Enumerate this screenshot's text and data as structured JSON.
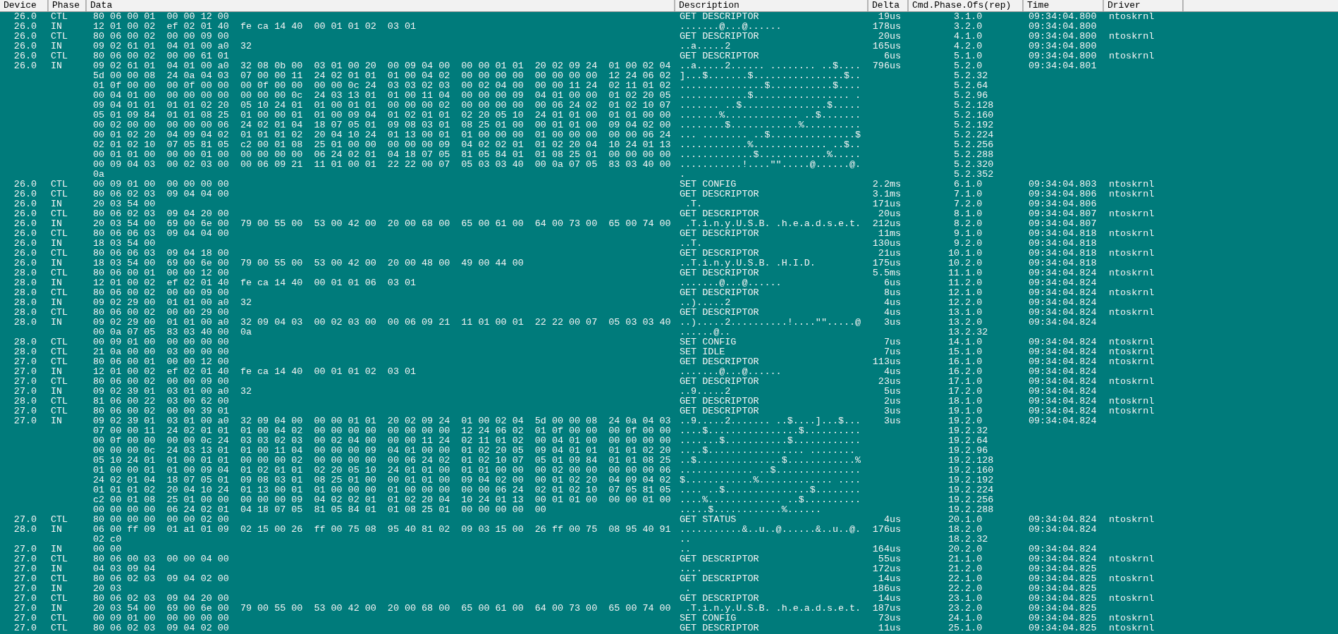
{
  "columns": [
    "Device",
    "Phase",
    "Data",
    "Description",
    "Delta",
    "Cmd.Phase.Ofs(rep)",
    "Time",
    "Driver"
  ],
  "rows": [
    {
      "device": "26.0",
      "phase": "CTL",
      "data": [
        "80 06 00 01  00 00 12 00"
      ],
      "description": [
        "GET DESCRIPTOR"
      ],
      "delta": "19us",
      "cmd": [
        "3.1.0"
      ],
      "time": "09:34:04.800",
      "driver": "ntoskrnl"
    },
    {
      "device": "26.0",
      "phase": "IN",
      "data": [
        "12 01 00 02  ef 02 01 40  fe ca 14 40  00 01 01 02  03 01"
      ],
      "description": [
        ".......@...@......"
      ],
      "delta": "178us",
      "cmd": [
        "3.2.0"
      ],
      "time": "09:34:04.800"
    },
    {
      "device": "26.0",
      "phase": "CTL",
      "data": [
        "80 06 00 02  00 00 09 00"
      ],
      "description": [
        "GET DESCRIPTOR"
      ],
      "delta": "20us",
      "cmd": [
        "4.1.0"
      ],
      "time": "09:34:04.800",
      "driver": "ntoskrnl"
    },
    {
      "device": "26.0",
      "phase": "IN",
      "data": [
        "09 02 61 01  04 01 00 a0  32"
      ],
      "description": [
        "..a.....2"
      ],
      "delta": "165us",
      "cmd": [
        "4.2.0"
      ],
      "time": "09:34:04.800"
    },
    {
      "device": "26.0",
      "phase": "CTL",
      "data": [
        "80 06 00 02  00 00 61 01"
      ],
      "description": [
        "GET DESCRIPTOR"
      ],
      "delta": "6us",
      "cmd": [
        "5.1.0"
      ],
      "time": "09:34:04.800",
      "driver": "ntoskrnl"
    },
    {
      "device": "26.0",
      "phase": "IN",
      "data": [
        "09 02 61 01  04 01 00 a0  32 08 0b 00  03 01 00 20  00 09 04 00  00 00 01 01  20 02 09 24  01 00 02 04",
        "5d 00 00 08  24 0a 04 03  07 00 00 11  24 02 01 01  01 00 04 02  00 00 00 00  00 00 00 00  12 24 06 02",
        "01 0f 00 00  00 0f 00 00  00 0f 00 00  00 00 0c 24  03 03 02 03  00 02 04 00  00 00 11 24  02 11 01 02",
        "00 04 01 00  00 00 00 00  00 00 00 0c  24 03 13 01  01 00 11 04  00 00 00 09  04 01 00 00  01 02 20 05",
        "09 04 01 01  01 01 02 20  05 10 24 01  01 00 01 01  00 00 00 02  00 00 00 00  00 06 24 02  01 02 10 07",
        "05 01 09 84  01 01 08 25  01 00 00 01  01 00 09 04  01 02 01 01  02 20 05 10  24 01 01 00  01 01 00 00",
        "00 02 00 00  00 00 00 06  24 02 01 04  18 07 05 01  09 08 03 01  08 25 01 00  00 01 01 00  09 04 02 00",
        "00 01 02 20  04 09 04 02  01 01 01 02  20 04 10 24  01 13 00 01  01 00 00 00  01 00 00 00  00 00 06 24",
        "02 01 02 10  07 05 81 05  c2 00 01 08  25 01 00 00  00 00 00 09  04 02 02 01  01 02 20 04  10 24 01 13",
        "00 01 01 00  00 00 01 00  00 00 00 00  06 24 02 01  04 18 07 05  81 05 84 01  01 08 25 01  00 00 00 00",
        "00 09 04 03  00 02 03 00  00 06 09 21  11 01 00 01  22 22 00 07  05 03 03 40  00 0a 07 05  83 03 40 00",
        "0a"
      ],
      "description": [
        "..a.....2...... ........ ..$....",
        "]...$.......$................$..",
        "...............$...........$....",
        "............$................. .",
        "....... ..$...............$.....",
        ".......%............. ..$.......",
        "........$............%..........",
        "... ........ ..$...............$",
        "............%............. ..$..",
        ".............$............%.....",
        "...........!....\"\".....@......@.",
        "."
      ],
      "delta": "796us",
      "cmd": [
        "5.2.0",
        "5.2.32",
        "5.2.64",
        "5.2.96",
        "5.2.128",
        "5.2.160",
        "5.2.192",
        "5.2.224",
        "5.2.256",
        "5.2.288",
        "5.2.320",
        "5.2.352"
      ],
      "time": "09:34:04.801"
    },
    {
      "device": "26.0",
      "phase": "CTL",
      "data": [
        "00 09 01 00  00 00 00 00"
      ],
      "description": [
        "SET CONFIG"
      ],
      "delta": "2.2ms",
      "cmd": [
        "6.1.0"
      ],
      "time": "09:34:04.803",
      "driver": "ntoskrnl"
    },
    {
      "device": "26.0",
      "phase": "CTL",
      "data": [
        "80 06 02 03  09 04 04 00"
      ],
      "description": [
        "GET DESCRIPTOR"
      ],
      "delta": "3.1ms",
      "cmd": [
        "7.1.0"
      ],
      "time": "09:34:04.806",
      "driver": "ntoskrnl"
    },
    {
      "device": "26.0",
      "phase": "IN",
      "data": [
        "20 03 54 00"
      ],
      "description": [
        " .T."
      ],
      "delta": "171us",
      "cmd": [
        "7.2.0"
      ],
      "time": "09:34:04.806"
    },
    {
      "device": "26.0",
      "phase": "CTL",
      "data": [
        "80 06 02 03  09 04 20 00"
      ],
      "description": [
        "GET DESCRIPTOR"
      ],
      "delta": "20us",
      "cmd": [
        "8.1.0"
      ],
      "time": "09:34:04.807",
      "driver": "ntoskrnl"
    },
    {
      "device": "26.0",
      "phase": "IN",
      "data": [
        "20 03 54 00  69 00 6e 00  79 00 55 00  53 00 42 00  20 00 68 00  65 00 61 00  64 00 73 00  65 00 74 00"
      ],
      "description": [
        " .T.i.n.y.U.S.B. .h.e.a.d.s.e.t."
      ],
      "delta": "212us",
      "cmd": [
        "8.2.0"
      ],
      "time": "09:34:04.807"
    },
    {
      "device": "26.0",
      "phase": "CTL",
      "data": [
        "80 06 06 03  09 04 04 00"
      ],
      "description": [
        "GET DESCRIPTOR"
      ],
      "delta": "11ms",
      "cmd": [
        "9.1.0"
      ],
      "time": "09:34:04.818",
      "driver": "ntoskrnl"
    },
    {
      "device": "26.0",
      "phase": "IN",
      "data": [
        "18 03 54 00"
      ],
      "description": [
        "..T."
      ],
      "delta": "130us",
      "cmd": [
        "9.2.0"
      ],
      "time": "09:34:04.818"
    },
    {
      "device": "26.0",
      "phase": "CTL",
      "data": [
        "80 06 06 03  09 04 18 00"
      ],
      "description": [
        "GET DESCRIPTOR"
      ],
      "delta": "21us",
      "cmd": [
        "10.1.0"
      ],
      "time": "09:34:04.818",
      "driver": "ntoskrnl"
    },
    {
      "device": "26.0",
      "phase": "IN",
      "data": [
        "18 03 54 00  69 00 6e 00  79 00 55 00  53 00 42 00  20 00 48 00  49 00 44 00"
      ],
      "description": [
        "..T.i.n.y.U.S.B. .H.I.D."
      ],
      "delta": "175us",
      "cmd": [
        "10.2.0"
      ],
      "time": "09:34:04.818"
    },
    {
      "device": "28.0",
      "phase": "CTL",
      "data": [
        "80 06 00 01  00 00 12 00"
      ],
      "description": [
        "GET DESCRIPTOR"
      ],
      "delta": "5.5ms",
      "cmd": [
        "11.1.0"
      ],
      "time": "09:34:04.824",
      "driver": "ntoskrnl"
    },
    {
      "device": "28.0",
      "phase": "IN",
      "data": [
        "12 01 00 02  ef 02 01 40  fe ca 14 40  00 01 01 06  03 01"
      ],
      "description": [
        ".......@...@......"
      ],
      "delta": "6us",
      "cmd": [
        "11.2.0"
      ],
      "time": "09:34:04.824"
    },
    {
      "device": "28.0",
      "phase": "CTL",
      "data": [
        "80 06 00 02  00 00 09 00"
      ],
      "description": [
        "GET DESCRIPTOR"
      ],
      "delta": "8us",
      "cmd": [
        "12.1.0"
      ],
      "time": "09:34:04.824",
      "driver": "ntoskrnl"
    },
    {
      "device": "28.0",
      "phase": "IN",
      "data": [
        "09 02 29 00  01 01 00 a0  32"
      ],
      "description": [
        "..).....2"
      ],
      "delta": "4us",
      "cmd": [
        "12.2.0"
      ],
      "time": "09:34:04.824"
    },
    {
      "device": "28.0",
      "phase": "CTL",
      "data": [
        "80 06 00 02  00 00 29 00"
      ],
      "description": [
        "GET DESCRIPTOR"
      ],
      "delta": "4us",
      "cmd": [
        "13.1.0"
      ],
      "time": "09:34:04.824",
      "driver": "ntoskrnl"
    },
    {
      "device": "28.0",
      "phase": "IN",
      "data": [
        "09 02 29 00  01 01 00 a0  32 09 04 03  00 02 03 00  00 06 09 21  11 01 00 01  22 22 00 07  05 03 03 40",
        "00 0a 07 05  83 03 40 00  0a"
      ],
      "description": [
        "..).....2..........!....\"\".....@",
        "......@.."
      ],
      "delta": "3us",
      "cmd": [
        "13.2.0",
        "13.2.32"
      ],
      "time": "09:34:04.824"
    },
    {
      "device": "28.0",
      "phase": "CTL",
      "data": [
        "00 09 01 00  00 00 00 00"
      ],
      "description": [
        "SET CONFIG"
      ],
      "delta": "7us",
      "cmd": [
        "14.1.0"
      ],
      "time": "09:34:04.824",
      "driver": "ntoskrnl"
    },
    {
      "device": "28.0",
      "phase": "CTL",
      "data": [
        "21 0a 00 00  03 00 00 00"
      ],
      "description": [
        "SET IDLE"
      ],
      "delta": "7us",
      "cmd": [
        "15.1.0"
      ],
      "time": "09:34:04.824",
      "driver": "ntoskrnl"
    },
    {
      "device": "27.0",
      "phase": "CTL",
      "data": [
        "80 06 00 01  00 00 12 00"
      ],
      "description": [
        "GET DESCRIPTOR"
      ],
      "delta": "113us",
      "cmd": [
        "16.1.0"
      ],
      "time": "09:34:04.824",
      "driver": "ntoskrnl"
    },
    {
      "device": "27.0",
      "phase": "IN",
      "data": [
        "12 01 00 02  ef 02 01 40  fe ca 14 40  00 01 01 02  03 01"
      ],
      "description": [
        ".......@...@......"
      ],
      "delta": "4us",
      "cmd": [
        "16.2.0"
      ],
      "time": "09:34:04.824"
    },
    {
      "device": "27.0",
      "phase": "CTL",
      "data": [
        "80 06 00 02  00 00 09 00"
      ],
      "description": [
        "GET DESCRIPTOR"
      ],
      "delta": "23us",
      "cmd": [
        "17.1.0"
      ],
      "time": "09:34:04.824",
      "driver": "ntoskrnl"
    },
    {
      "device": "27.0",
      "phase": "IN",
      "data": [
        "09 02 39 01  03 01 00 a0  32"
      ],
      "description": [
        "..9.....2"
      ],
      "delta": "5us",
      "cmd": [
        "17.2.0"
      ],
      "time": "09:34:04.824"
    },
    {
      "device": "28.0",
      "phase": "CTL",
      "data": [
        "81 06 00 22  03 00 62 00"
      ],
      "description": [
        "GET DESCRIPTOR"
      ],
      "delta": "2us",
      "cmd": [
        "18.1.0"
      ],
      "time": "09:34:04.824",
      "driver": "ntoskrnl"
    },
    {
      "device": "27.0",
      "phase": "CTL",
      "data": [
        "80 06 00 02  00 00 39 01"
      ],
      "description": [
        "GET DESCRIPTOR"
      ],
      "delta": "3us",
      "cmd": [
        "19.1.0"
      ],
      "time": "09:34:04.824",
      "driver": "ntoskrnl"
    },
    {
      "device": "27.0",
      "phase": "IN",
      "data": [
        "09 02 39 01  03 01 00 a0  32 09 04 00  00 00 01 01  20 02 09 24  01 00 02 04  5d 00 00 08  24 0a 04 03",
        "07 00 00 11  24 02 01 01  01 00 04 02  00 00 00 00  00 00 00 00  12 24 06 02  01 0f 00 00  00 0f 00 00",
        "00 0f 00 00  00 00 0c 24  03 03 02 03  00 02 04 00  00 00 11 24  02 11 01 02  00 04 01 00  00 00 00 00",
        "00 00 00 0c  24 03 13 01  01 00 11 04  00 00 00 09  04 01 00 00  01 02 20 05  09 04 01 01  01 01 02 20",
        "05 10 24 01  01 00 01 01  00 00 00 02  00 00 00 00  00 06 24 02  01 02 10 07  05 01 09 84  01 01 08 25",
        "01 00 00 01  01 00 09 04  01 02 01 01  02 20 05 10  24 01 01 00  01 01 00 00  00 02 00 00  00 00 00 06",
        "24 02 01 04  18 07 05 01  09 08 03 01  08 25 01 00  00 01 01 00  09 04 02 00  00 01 02 20  04 09 04 02",
        "01 01 01 02  20 04 10 24  01 13 00 01  01 00 00 00  01 00 00 00  00 00 06 24  02 01 02 10  07 05 81 05",
        "c2 00 01 08  25 01 00 00  00 00 00 09  04 02 02 01  01 02 20 04  10 24 01 13  00 01 01 00  00 00 01 00",
        "00 00 00 00  06 24 02 01  04 18 07 05  81 05 84 01  01 08 25 01  00 00 00 00  00"
      ],
      "description": [
        "..9.....2....... ..$....]...$...",
        "....$................$..........",
        ".......$...........$............",
        "....$................. ........",
        "..$...............$............%",
        "............. ..$...............",
        "$............%............. ....",
        ".... ..$...............$........",
        "....%............. ..$..........",
        ".....$............%......"
      ],
      "delta": "3us",
      "cmd": [
        "19.2.0",
        "19.2.32",
        "19.2.64",
        "19.2.96",
        "19.2.128",
        "19.2.160",
        "19.2.192",
        "19.2.224",
        "19.2.256",
        "19.2.288"
      ],
      "time": "09:34:04.824"
    },
    {
      "device": "27.0",
      "phase": "CTL",
      "data": [
        "80 00 00 00  00 00 02 00"
      ],
      "description": [
        "GET STATUS"
      ],
      "delta": "4us",
      "cmd": [
        "20.1.0"
      ],
      "time": "09:34:04.824",
      "driver": "ntoskrnl"
    },
    {
      "device": "28.0",
      "phase": "IN",
      "data": [
        "06 00 ff 09  01 a1 01 09  02 15 00 26  ff 00 75 08  95 40 81 02  09 03 15 00  26 ff 00 75  08 95 40 91",
        "02 c0"
      ],
      "description": [
        "...........&..u..@......&..u..@.",
        ".."
      ],
      "delta": "176us",
      "cmd": [
        "18.2.0",
        "18.2.32"
      ],
      "time": "09:34:04.824"
    },
    {
      "device": "27.0",
      "phase": "IN",
      "data": [
        "00 00"
      ],
      "description": [
        ".."
      ],
      "delta": "164us",
      "cmd": [
        "20.2.0"
      ],
      "time": "09:34:04.824"
    },
    {
      "device": "27.0",
      "phase": "CTL",
      "data": [
        "80 06 00 03  00 00 04 00"
      ],
      "description": [
        "GET DESCRIPTOR"
      ],
      "delta": "55us",
      "cmd": [
        "21.1.0"
      ],
      "time": "09:34:04.824",
      "driver": "ntoskrnl"
    },
    {
      "device": "27.0",
      "phase": "IN",
      "data": [
        "04 03 09 04"
      ],
      "description": [
        "...."
      ],
      "delta": "172us",
      "cmd": [
        "21.2.0"
      ],
      "time": "09:34:04.825"
    },
    {
      "device": "27.0",
      "phase": "CTL",
      "data": [
        "80 06 02 03  09 04 02 00"
      ],
      "description": [
        "GET DESCRIPTOR"
      ],
      "delta": "14us",
      "cmd": [
        "22.1.0"
      ],
      "time": "09:34:04.825",
      "driver": "ntoskrnl"
    },
    {
      "device": "27.0",
      "phase": "IN",
      "data": [
        "20 03"
      ],
      "description": [
        " ."
      ],
      "delta": "186us",
      "cmd": [
        "22.2.0"
      ],
      "time": "09:34:04.825"
    },
    {
      "device": "27.0",
      "phase": "CTL",
      "data": [
        "80 06 02 03  09 04 20 00"
      ],
      "description": [
        "GET DESCRIPTOR"
      ],
      "delta": "14us",
      "cmd": [
        "23.1.0"
      ],
      "time": "09:34:04.825",
      "driver": "ntoskrnl"
    },
    {
      "device": "27.0",
      "phase": "IN",
      "data": [
        "20 03 54 00  69 00 6e 00  79 00 55 00  53 00 42 00  20 00 68 00  65 00 61 00  64 00 73 00  65 00 74 00"
      ],
      "description": [
        " .T.i.n.y.U.S.B. .h.e.a.d.s.e.t."
      ],
      "delta": "187us",
      "cmd": [
        "23.2.0"
      ],
      "time": "09:34:04.825"
    },
    {
      "device": "27.0",
      "phase": "CTL",
      "data": [
        "00 09 01 00  00 00 00 00"
      ],
      "description": [
        "SET CONFIG"
      ],
      "delta": "73us",
      "cmd": [
        "24.1.0"
      ],
      "time": "09:34:04.825",
      "driver": "ntoskrnl"
    },
    {
      "device": "27.0",
      "phase": "CTL",
      "data": [
        "80 06 02 03  09 04 02 00"
      ],
      "description": [
        "GET DESCRIPTOR"
      ],
      "delta": "11us",
      "cmd": [
        "25.1.0"
      ],
      "time": "09:34:04.825",
      "driver": "ntoskrnl"
    }
  ]
}
